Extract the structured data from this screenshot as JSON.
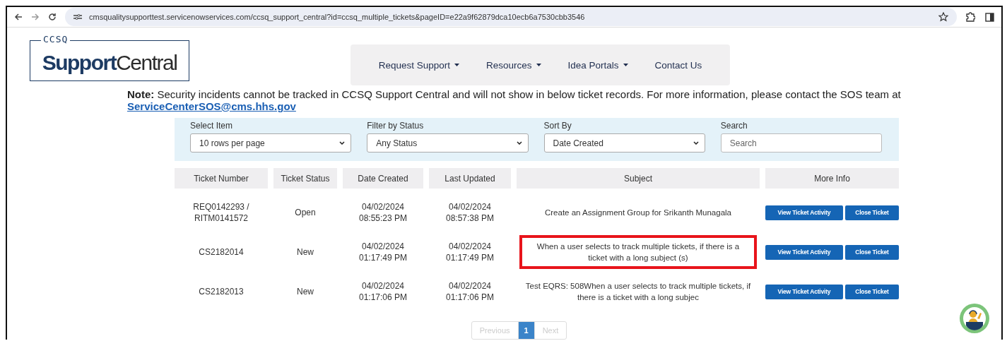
{
  "browser": {
    "url": "cmsqualitysupporttest.servicenowservices.com/ccsq_support_central?id=ccsq_multiple_tickets&pageID=e22a9f62879dca10ecb6a7530cbb3546"
  },
  "logo": {
    "overline": "CCSQ",
    "name_parts": [
      "Support",
      "Central"
    ]
  },
  "nav": [
    {
      "label": "Request Support",
      "dropdown": true
    },
    {
      "label": "Resources",
      "dropdown": true
    },
    {
      "label": "Idea Portals",
      "dropdown": true
    },
    {
      "label": "Contact Us",
      "dropdown": false
    }
  ],
  "note": {
    "label": "Note:",
    "text": "Security incidents cannot be tracked in CCSQ Support Central and will not show in below ticket records. For more information, please contact the SOS team at",
    "link": "ServiceCenterSOS@cms.hhs.gov"
  },
  "filters": [
    {
      "label": "Select Item",
      "kind": "select",
      "value": "10 rows per page"
    },
    {
      "label": "Filter by Status",
      "kind": "select",
      "value": "Any Status"
    },
    {
      "label": "Sort By",
      "kind": "select",
      "value": "Date Created"
    },
    {
      "label": "Search",
      "kind": "input",
      "placeholder": "Search"
    }
  ],
  "table": {
    "columns": [
      "Ticket Number",
      "Ticket Status",
      "Date Created",
      "Last Updated",
      "Subject",
      "More Info"
    ],
    "rows": [
      {
        "ticket": "REQ0142293 / RITM0141572",
        "status": "Open",
        "created": "04/02/2024\n08:55:23 PM",
        "updated": "04/02/2024\n08:57:38 PM",
        "subject": "Create an Assignment Group for Srikanth Munagala",
        "highlighted": false,
        "actions": [
          "View Ticket Activity",
          "Close Ticket"
        ]
      },
      {
        "ticket": "CS2182014",
        "status": "New",
        "created": "04/02/2024\n01:17:49 PM",
        "updated": "04/02/2024\n01:17:49 PM",
        "subject": "When a user selects to track multiple tickets, if there is a ticket with a long subject (s)",
        "highlighted": true,
        "actions": [
          "View Ticket Activity",
          "Close Ticket"
        ]
      },
      {
        "ticket": "CS2182013",
        "status": "New",
        "created": "04/02/2024\n01:17:06 PM",
        "updated": "04/02/2024\n01:17:06 PM",
        "subject": "Test EQRS: 508When a user selects to track multiple tickets, if there is a ticket with a long subjec",
        "highlighted": false,
        "actions": [
          "View Ticket Activity",
          "Close Ticket"
        ]
      }
    ]
  },
  "pagination": [
    {
      "label": "Previous",
      "selected": false,
      "disabled": true
    },
    {
      "label": "1",
      "selected": true,
      "disabled": false
    },
    {
      "label": "Next",
      "selected": false,
      "disabled": true
    }
  ]
}
